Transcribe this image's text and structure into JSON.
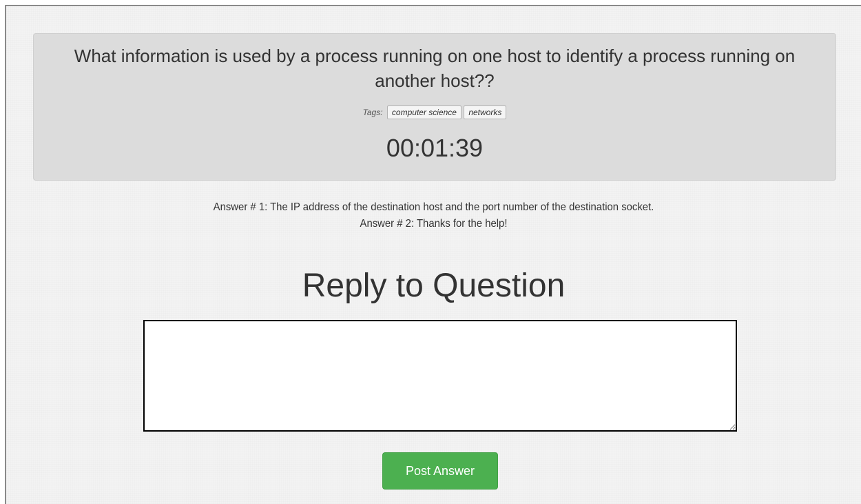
{
  "question": {
    "text": "What information is used by a process running on one host to identify a process running on another host??",
    "tags_label": "Tags:",
    "tags": [
      "computer science",
      "networks"
    ],
    "timer": "00:01:39"
  },
  "answers": [
    "Answer # 1: The IP address of the destination host and the port number of the destination socket.",
    "Answer # 2: Thanks for the help!"
  ],
  "reply": {
    "heading": "Reply to Question",
    "value": "",
    "submit_label": "Post Answer"
  },
  "colors": {
    "panel_background": "#dcdcdc",
    "submit_button": "#4cb050",
    "page_background": "#f3f3f3"
  }
}
